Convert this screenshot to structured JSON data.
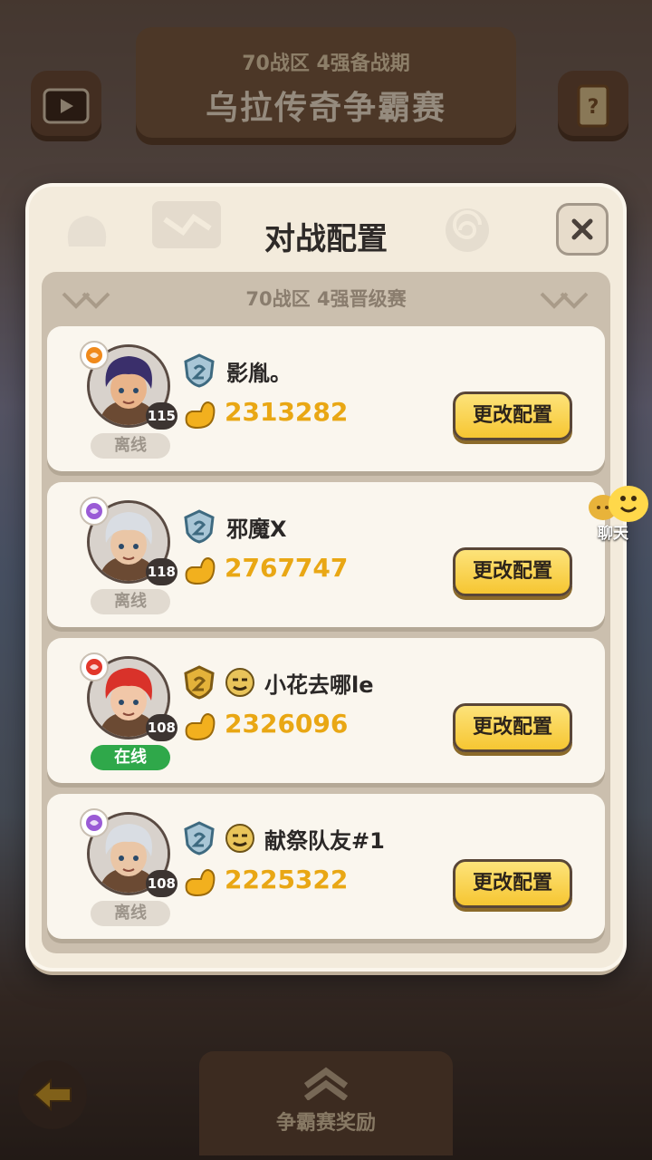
{
  "background": {
    "banner_subtitle": "70战区 4强备战期",
    "banner_title": "乌拉传奇争霸赛",
    "left_icon": "video-icon",
    "right_icon": "scroll-icon",
    "bottom_label": "争霸赛奖励",
    "back_icon": "back-arrow-icon"
  },
  "modal": {
    "title": "对战配置",
    "close_icon": "close-icon",
    "section_title": "70战区 4强晋级赛"
  },
  "players": [
    {
      "name": "影胤。",
      "power": "2313282",
      "level": "115",
      "status": "离线",
      "online": false,
      "button": "更改配置",
      "rank": "silver",
      "pet": false,
      "class_color": "#f08a1c",
      "hair": "#3a2f6b",
      "skin": "#e9b48a"
    },
    {
      "name": "邪魔X",
      "power": "2767747",
      "level": "118",
      "status": "离线",
      "online": false,
      "button": "更改配置",
      "rank": "silver",
      "pet": false,
      "class_color": "#9a5bd6",
      "hair": "#d9dde3",
      "skin": "#eac6a6"
    },
    {
      "name": "小花去哪le",
      "power": "2326096",
      "level": "108",
      "status": "在线",
      "online": true,
      "button": "更改配置",
      "rank": "gold",
      "pet": true,
      "class_color": "#e2372b",
      "hair": "#d9322a",
      "skin": "#f1c7a8"
    },
    {
      "name": "献祭队友#1",
      "power": "2225322",
      "level": "108",
      "status": "离线",
      "online": false,
      "button": "更改配置",
      "rank": "silver",
      "pet": true,
      "class_color": "#9a5bd6",
      "hair": "#d9dde3",
      "skin": "#eac6a6"
    }
  ],
  "chat": {
    "label": "聊天"
  },
  "colors": {
    "power": "#e9a714",
    "online": "#2fa84a",
    "button": "#f6c632"
  }
}
